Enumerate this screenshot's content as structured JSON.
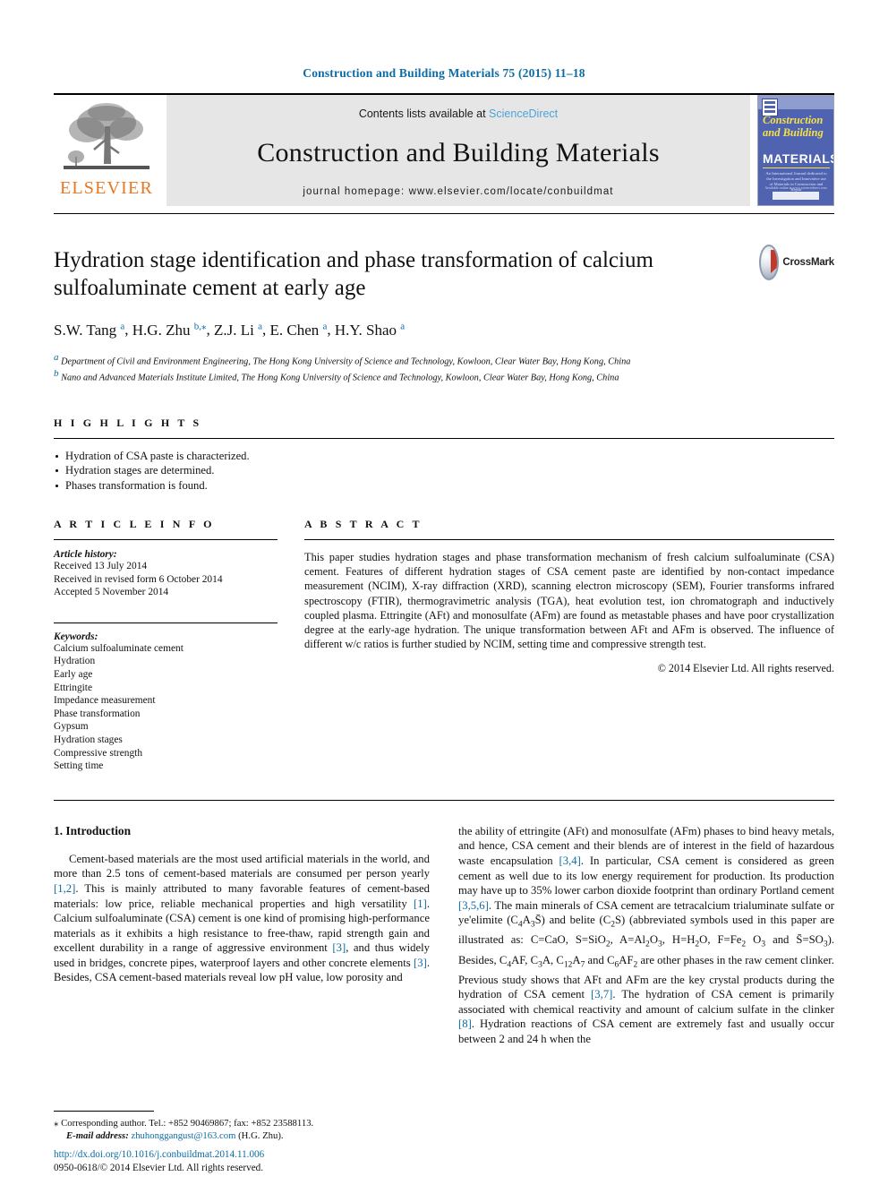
{
  "running_head": "Construction and Building Materials 75 (2015) 11–18",
  "masthead": {
    "contents_prefix": "Contents lists available at ",
    "sciencedirect": "ScienceDirect",
    "journal_name": "Construction and Building Materials",
    "homepage": "journal homepage: www.elsevier.com/locate/conbuildmat",
    "publisher_name": "ELSEVIER",
    "cover": {
      "title_line1": "Construction",
      "title_line2": "and Building",
      "materials": "MATERIALS",
      "subtitle": "An International Journal dedicated to the Investigation and Innovative use of Materials in Construction and Repair",
      "footer_label": "Available online at www.sciencedirect.com"
    }
  },
  "article": {
    "title": "Hydration stage identification and phase transformation of calcium sulfoaluminate cement at early age",
    "authors": [
      {
        "name": "S.W. Tang",
        "marks": "a",
        "corresponding": false
      },
      {
        "name": "H.G. Zhu",
        "marks": "b",
        "corresponding": true
      },
      {
        "name": "Z.J. Li",
        "marks": "a",
        "corresponding": false
      },
      {
        "name": "E. Chen",
        "marks": "a",
        "corresponding": false
      },
      {
        "name": "H.Y. Shao",
        "marks": "a",
        "corresponding": false
      }
    ],
    "affiliations": [
      {
        "mark": "a",
        "text": "Department of Civil and Environment Engineering, The Hong Kong University of Science and Technology, Kowloon, Clear Water Bay, Hong Kong, China"
      },
      {
        "mark": "b",
        "text": "Nano and Advanced Materials Institute Limited, The Hong Kong University of Science and Technology, Kowloon, Clear Water Bay, Hong Kong, China"
      }
    ],
    "crossmark_label": "CrossMark"
  },
  "highlights": {
    "heading": "H I G H L I G H T S",
    "items": [
      "Hydration of CSA paste is characterized.",
      "Hydration stages are determined.",
      "Phases transformation is found."
    ]
  },
  "article_info": {
    "heading": "A R T I C L E   I N F O",
    "history_label": "Article history:",
    "history": [
      "Received 13 July 2014",
      "Received in revised form 6 October 2014",
      "Accepted 5 November 2014"
    ],
    "keywords_label": "Keywords:",
    "keywords": [
      "Calcium sulfoaluminate cement",
      "Hydration",
      "Early age",
      "Ettringite",
      "Impedance measurement",
      "Phase transformation",
      "Gypsum",
      "Hydration stages",
      "Compressive strength",
      "Setting time"
    ]
  },
  "abstract": {
    "heading": "A B S T R A C T",
    "text": "This paper studies hydration stages and phase transformation mechanism of fresh calcium sulfoaluminate (CSA) cement. Features of different hydration stages of CSA cement paste are identified by non-contact impedance measurement (NCIM), X-ray diffraction (XRD), scanning electron microscopy (SEM), Fourier transforms infrared spectroscopy (FTIR), thermogravimetric analysis (TGA), heat evolution test, ion chromatograph and inductively coupled plasma. Ettringite (AFt) and monosulfate (AFm) are found as metastable phases and have poor crystallization degree at the early-age hydration. The unique transformation between AFt and AFm is observed. The influence of different w/c ratios is further studied by NCIM, setting time and compressive strength test.",
    "copyright": "© 2014 Elsevier Ltd. All rights reserved."
  },
  "body": {
    "section_heading": "1. Introduction",
    "left_paragraph_parts": [
      {
        "t": "Cement-based materials are the most used artificial materials in the world, and more than 2.5 tons of cement-based materials are consumed per person yearly "
      },
      {
        "t": "[1,2]",
        "ref": true
      },
      {
        "t": ". This is mainly attributed to many favorable features of cement-based materials: low price, reliable mechanical properties and high versatility "
      },
      {
        "t": "[1]",
        "ref": true
      },
      {
        "t": ". Calcium sulfoaluminate (CSA) cement is one kind of promising high-performance materials as it exhibits a high resistance to free-thaw, rapid strength gain and excellent durability in a range of aggressive environment "
      },
      {
        "t": "[3]",
        "ref": true
      },
      {
        "t": ", and thus widely used in bridges, concrete pipes, waterproof layers and other concrete elements "
      },
      {
        "t": "[3]",
        "ref": true
      },
      {
        "t": ". Besides, CSA cement-based materials reveal low pH value, low porosity and"
      }
    ],
    "right_paragraph_parts": [
      {
        "t": "the ability of ettringite (AFt) and monosulfate (AFm) phases to bind heavy metals, and hence, CSA cement and their blends are of interest in the field of hazardous waste encapsulation "
      },
      {
        "t": "[3,4]",
        "ref": true
      },
      {
        "t": ". In particular, CSA cement is considered as green cement as well due to its low energy requirement for production. Its production may have up to 35% lower carbon dioxide footprint than ordinary Portland cement "
      },
      {
        "t": "[3,5,6]",
        "ref": true
      },
      {
        "t": ". The main minerals of CSA cement are tetracalcium trialuminate sulfate or ye'elimite (C",
        "sub_after": "4"
      },
      {
        "t": "A",
        "sub_after": "3"
      },
      {
        "t": "S̄) and belite (C",
        "sub_after": "2"
      },
      {
        "t": "S) (abbreviated symbols used in this paper are illustrated as: C=CaO, S=SiO",
        "sub_after": "2"
      },
      {
        "t": ", A=Al",
        "sub_after": "2"
      },
      {
        "t": "O",
        "sub_after": "3"
      },
      {
        "t": ", H=H",
        "sub_after": "2"
      },
      {
        "t": "O, F=Fe",
        "sub_after": "2"
      },
      {
        "t": " O",
        "sub_after": "3"
      },
      {
        "t": " and S̄=SO",
        "sub_after": "3"
      },
      {
        "t": "). Besides, C",
        "sub_after": "4"
      },
      {
        "t": "AF, C",
        "sub_after": "3"
      },
      {
        "t": "A, C",
        "sub_after": "12"
      },
      {
        "t": "A",
        "sub_after": "7"
      },
      {
        "t": " and C",
        "sub_after": "6"
      },
      {
        "t": "AF",
        "sub_after": "2"
      },
      {
        "t": " are other phases in the raw cement clinker. Previous study shows that AFt and AFm are the key crystal products during the hydration of CSA cement "
      },
      {
        "t": "[3,7]",
        "ref": true
      },
      {
        "t": ". The hydration of CSA cement is primarily associated with chemical reactivity and amount of calcium sulfate in the clinker "
      },
      {
        "t": "[8]",
        "ref": true
      },
      {
        "t": ". Hydration reactions of CSA cement are extremely fast and usually occur between 2 and 24 h when the"
      }
    ]
  },
  "footnote": {
    "corresponding_symbol": "⁎",
    "corresponding_text": "Corresponding author. Tel.: +852 90469867; fax: +852 23588113.",
    "email_label": "E-mail address:",
    "email": "zhuhonggangust@163.com",
    "email_owner": "(H.G. Zhu).",
    "doi": "http://dx.doi.org/10.1016/j.conbuildmat.2014.11.006",
    "issn_line": "0950-0618/© 2014 Elsevier Ltd. All rights reserved."
  },
  "colors": {
    "link_blue": "#0c6ba3",
    "sciencedirect_blue": "#4ea3d8",
    "elsevier_orange": "#e87722",
    "masthead_gray": "#e6e6e6"
  }
}
